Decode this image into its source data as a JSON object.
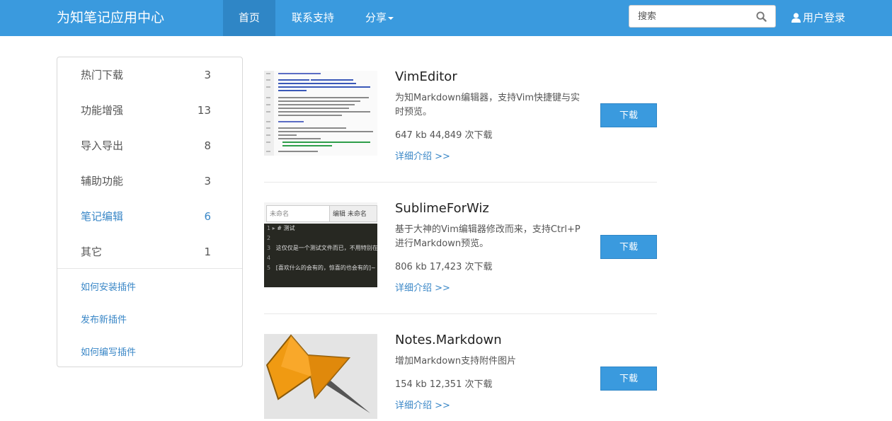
{
  "header": {
    "brand": "为知笔记应用中心",
    "nav": {
      "home": "首页",
      "support": "联系支持",
      "share": "分享"
    },
    "search_placeholder": "搜索",
    "login": "用户登录"
  },
  "sidebar": {
    "categories": [
      {
        "label": "热门下载",
        "count": "3"
      },
      {
        "label": "功能增强",
        "count": "13"
      },
      {
        "label": "导入导出",
        "count": "8"
      },
      {
        "label": "辅助功能",
        "count": "3"
      },
      {
        "label": "笔记编辑",
        "count": "6"
      },
      {
        "label": "其它",
        "count": "1"
      }
    ],
    "links": [
      "如何安装插件",
      "发布新插件",
      "如何编写插件"
    ]
  },
  "plugins": [
    {
      "name": "VimEditor",
      "desc": "为知Markdown编辑器，支持Vim快捷键与实时预览。",
      "stats": "647 kb 44,849 次下载",
      "more": "详细介绍 >>",
      "download": "下载"
    },
    {
      "name": "SublimeForWiz",
      "desc": "基于大神的Vim编辑器修改而来，支持Ctrl+P进行Markdown预览。",
      "stats": "806 kb 17,423 次下载",
      "more": "详细介绍 >>",
      "download": "下载"
    },
    {
      "name": "Notes.Markdown",
      "desc": "增加Markdown支持附件图片",
      "stats": "154 kb 12,351 次下载",
      "more": "详细介绍 >>",
      "download": "下载"
    }
  ],
  "thumb_text": {
    "tab1": "未命名",
    "tab2": "编辑 未命名",
    "line1": "# 测试",
    "line3": "这仅仅是一个测试文件而已，不用特别在意~ ~。",
    "line5": "[喜欢什么的会有的，惊喜的也会有的]~ ~ |"
  },
  "colors": {
    "navbar": "#3a9ade",
    "accent": "#3a87c7",
    "active_nav": "#2f86c6"
  }
}
